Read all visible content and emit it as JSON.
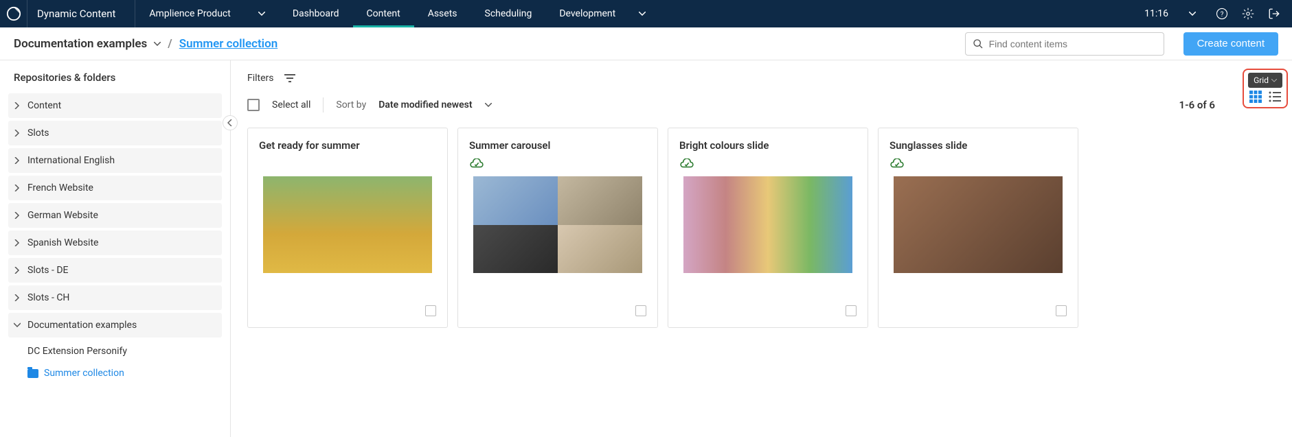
{
  "nav": {
    "brand": "Dynamic Content",
    "product": "Amplience Product",
    "tabs": [
      "Dashboard",
      "Content",
      "Assets",
      "Scheduling"
    ],
    "activeTab": 1,
    "dev": "Development",
    "time": "11:16"
  },
  "crumb": {
    "root": "Documentation examples",
    "sep": "/",
    "current": "Summer collection"
  },
  "search": {
    "placeholder": "Find content items"
  },
  "createBtn": "Create content",
  "sidebar": {
    "title": "Repositories & folders",
    "items": [
      "Content",
      "Slots",
      "International English",
      "French Website",
      "German Website",
      "Spanish Website",
      "Slots - DE",
      "Slots - CH",
      "Documentation examples"
    ],
    "subs": [
      {
        "label": "DC Extension Personify",
        "active": false
      },
      {
        "label": "Summer collection",
        "active": true
      }
    ]
  },
  "filters": {
    "label": "Filters"
  },
  "toolbar": {
    "selectAll": "Select all",
    "sortBy": "Sort by",
    "sortValue": "Date modified newest",
    "count": "1-6 of 6",
    "tooltip": "Grid"
  },
  "cards": [
    {
      "title": "Get ready for summer",
      "badge": false,
      "imgKind": "sunflower"
    },
    {
      "title": "Summer carousel",
      "badge": true,
      "imgKind": "quad"
    },
    {
      "title": "Bright colours slide",
      "badge": true,
      "imgKind": "colorful"
    },
    {
      "title": "Sunglasses slide",
      "badge": true,
      "imgKind": "sunglasses"
    }
  ]
}
